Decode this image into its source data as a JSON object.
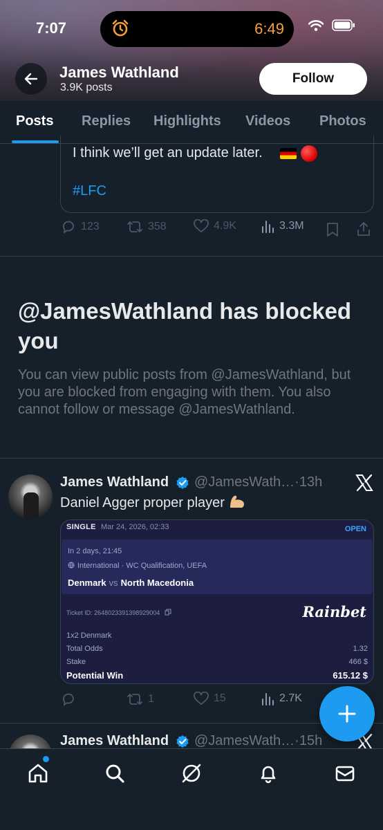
{
  "status_bar": {
    "time": "7:07",
    "alarm_time": "6:49",
    "alarm_color": "#f5a03c"
  },
  "header": {
    "name": "James Wathland",
    "posts_count": "3.9K posts",
    "follow_label": "Follow"
  },
  "tabs": [
    {
      "label": "Posts",
      "active": true
    },
    {
      "label": "Replies",
      "active": false
    },
    {
      "label": "Highlights",
      "active": false
    },
    {
      "label": "Videos",
      "active": false
    },
    {
      "label": "Photos",
      "active": false
    }
  ],
  "tweet1": {
    "text": "I think we’ll get an update later.",
    "hashtag": "#LFC",
    "replies": "123",
    "reposts": "358",
    "likes": "4.9K",
    "views": "3.3M"
  },
  "blocked": {
    "title": "@JamesWathland has blocked you",
    "description": "You can view public posts from @JamesWathland, but you are blocked from engaging with them. You also cannot follow or message @JamesWathland."
  },
  "tweet2": {
    "name": "James Wathland",
    "handle": "@JamesWath…",
    "time": "·13h",
    "text": "Daniel Agger proper player",
    "slip": {
      "type": "SINGLE",
      "date": "Mar 24, 2026, 02:33",
      "status": "OPEN",
      "when": "In 2 days, 21:45",
      "competition": "International · WC Qualification, UEFA",
      "home": "Denmark",
      "vs": "vs",
      "away": "North Macedonia",
      "ticket_id": "Ticket ID: 2648023391398929004",
      "brand": "Rainbet",
      "market": "1x2 Denmark",
      "total_odds_label": "Total Odds",
      "total_odds": "1.32",
      "stake_label": "Stake",
      "stake": "466 $",
      "potential_win_label": "Potential Win",
      "potential_win": "615.12 $"
    },
    "replies": "",
    "reposts": "1",
    "likes": "15",
    "views": "2.7K"
  },
  "tweet3": {
    "name": "James Wathland",
    "handle": "@JamesWath…",
    "time": "·15h"
  },
  "colors": {
    "accent": "#1d9bf0",
    "background": "#15202b",
    "border": "#38444d",
    "muted_text": "#71767b"
  }
}
